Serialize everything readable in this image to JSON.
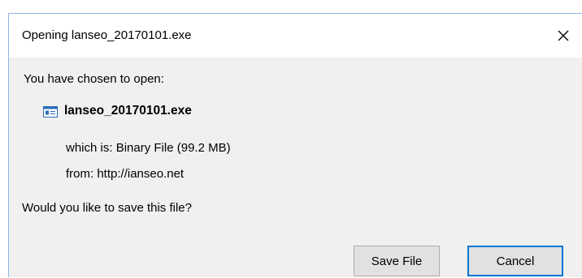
{
  "dialog": {
    "title": "Opening lanseo_20170101.exe",
    "prompt": "You have chosen to open:",
    "file": {
      "name": "lanseo_20170101.exe",
      "icon": "executable-file-icon"
    },
    "which_label": "which is:",
    "which_value": "Binary File (99.2 MB)",
    "from_label": "from:",
    "from_value": "http://ianseo.net",
    "question": "Would you like to save this file?",
    "buttons": {
      "save_label": "Save File",
      "cancel_label": "Cancel"
    },
    "colors": {
      "accent": "#0078d7",
      "border": "#8fb5e0",
      "background": "#f0f0f0"
    }
  }
}
